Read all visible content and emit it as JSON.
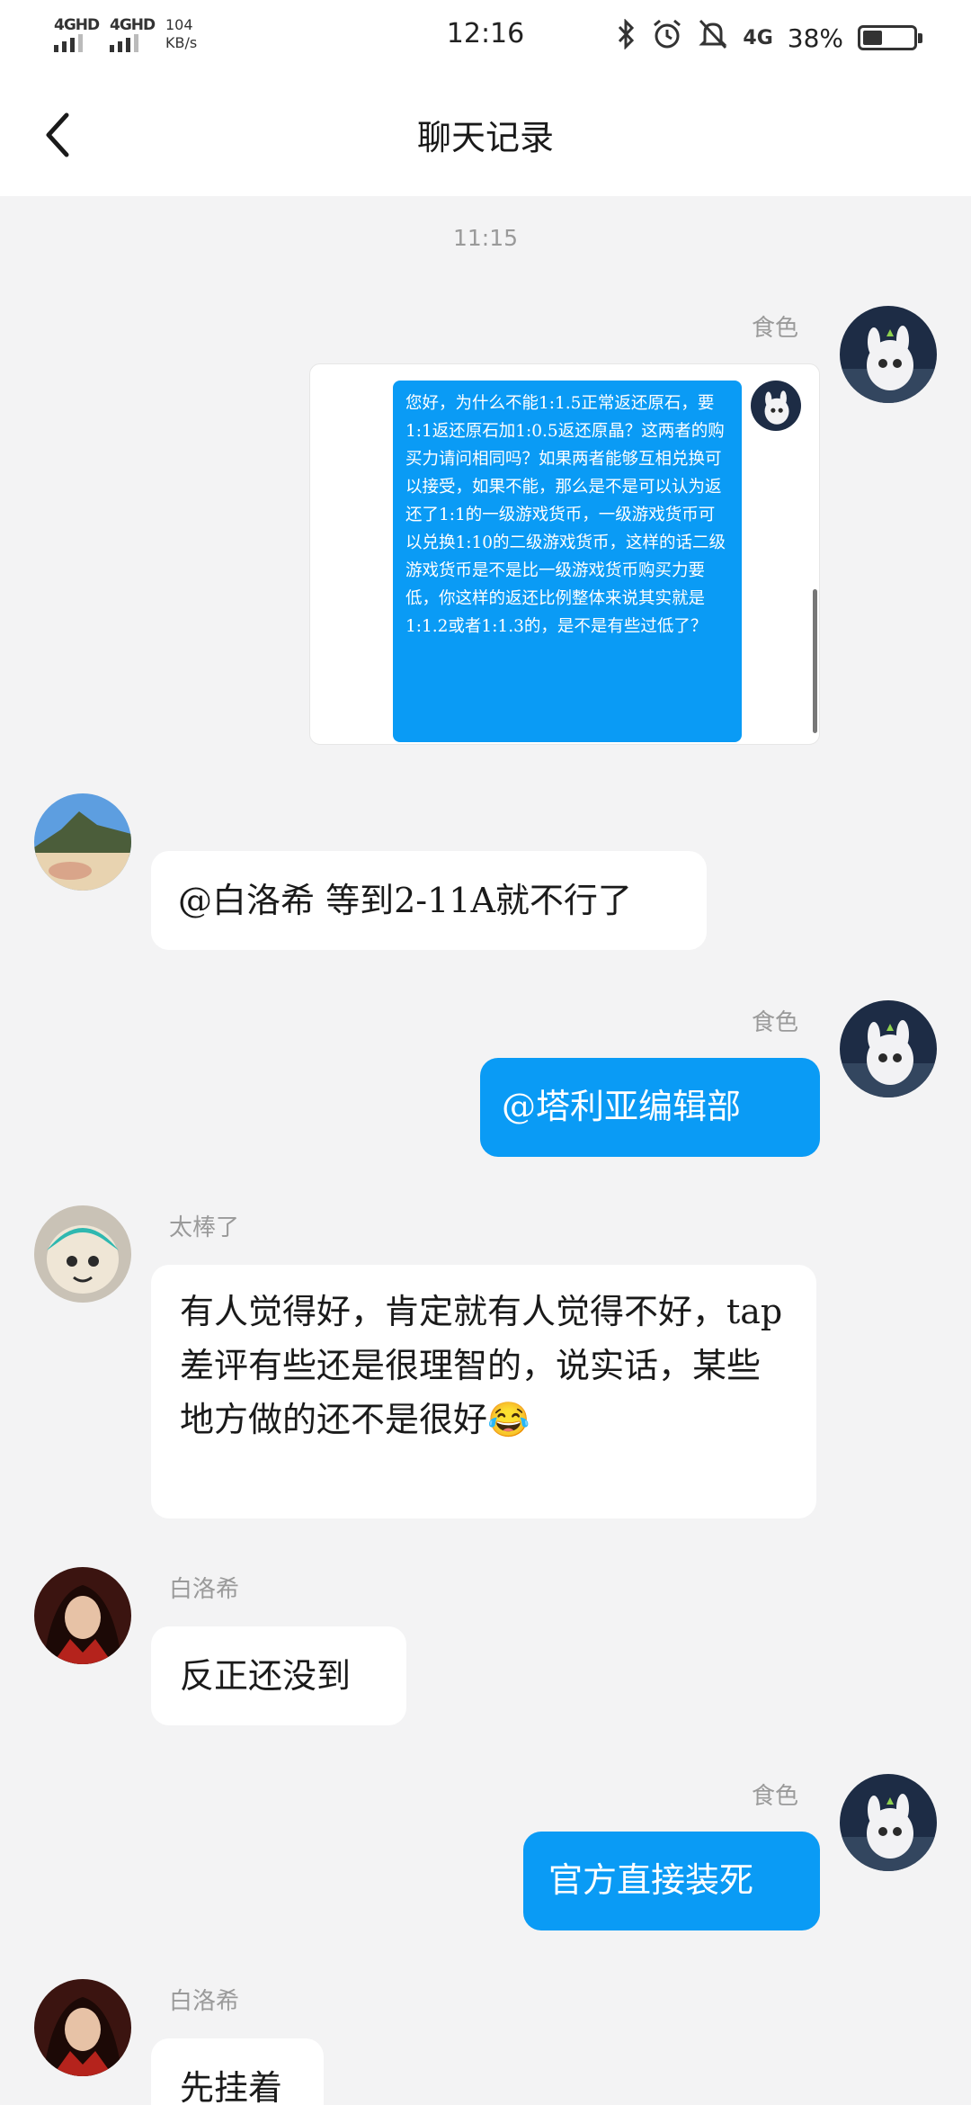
{
  "status_bar": {
    "sim1": "4GHD",
    "sim2": "4GHD",
    "speed_value": "104",
    "speed_unit": "KB/s",
    "time": "12:16",
    "bluetooth_icon": "bluetooth-icon",
    "alarm_icon": "alarm-icon",
    "mute_icon": "bell-off-icon",
    "network": "4G",
    "battery_pct": "38%",
    "battery_level": 0.38
  },
  "header": {
    "back_icon": "chevron-left-icon",
    "title": "聊天记录"
  },
  "chat": {
    "timestamp": "11:15",
    "messages": [
      {
        "sender": "食色",
        "side": "right",
        "type": "image-card",
        "text": "您好，为什么不能1:1.5正常返还原石，要1:1返还原石加1:0.5返还原晶？这两者的购买力请问相同吗？如果两者能够互相兑换可以接受，如果不能，那么是不是可以认为返还了1:1的一级游戏货币，一级游戏货币可以兑换1:10的二级游戏货币，这样的话二级游戏货币是不是比一级游戏货币购买力要低，你这样的返还比例整体来说其实就是1:1.2或者1:1.3的，是不是有些过低了？"
      },
      {
        "sender": "",
        "side": "left",
        "text": "@白洛希 等到2-11A就不行了"
      },
      {
        "sender": "食色",
        "side": "right",
        "text": "@塔利亚编辑部"
      },
      {
        "sender": "太棒了",
        "side": "left",
        "text": "有人觉得好，肯定就有人觉得不好，tap差评有些还是很理智的，说实话，某些地方做的还不是很好😂"
      },
      {
        "sender": "白洛希",
        "side": "left",
        "text": "反正还没到"
      },
      {
        "sender": "食色",
        "side": "right",
        "text": "官方直接装死"
      },
      {
        "sender": "白洛希",
        "side": "left",
        "text": "先挂着"
      }
    ]
  },
  "colors": {
    "background": "#f3f3f4",
    "bubble_right": "#0a9bf5",
    "bubble_left": "#ffffff",
    "meta_text": "#9a9a9a"
  }
}
